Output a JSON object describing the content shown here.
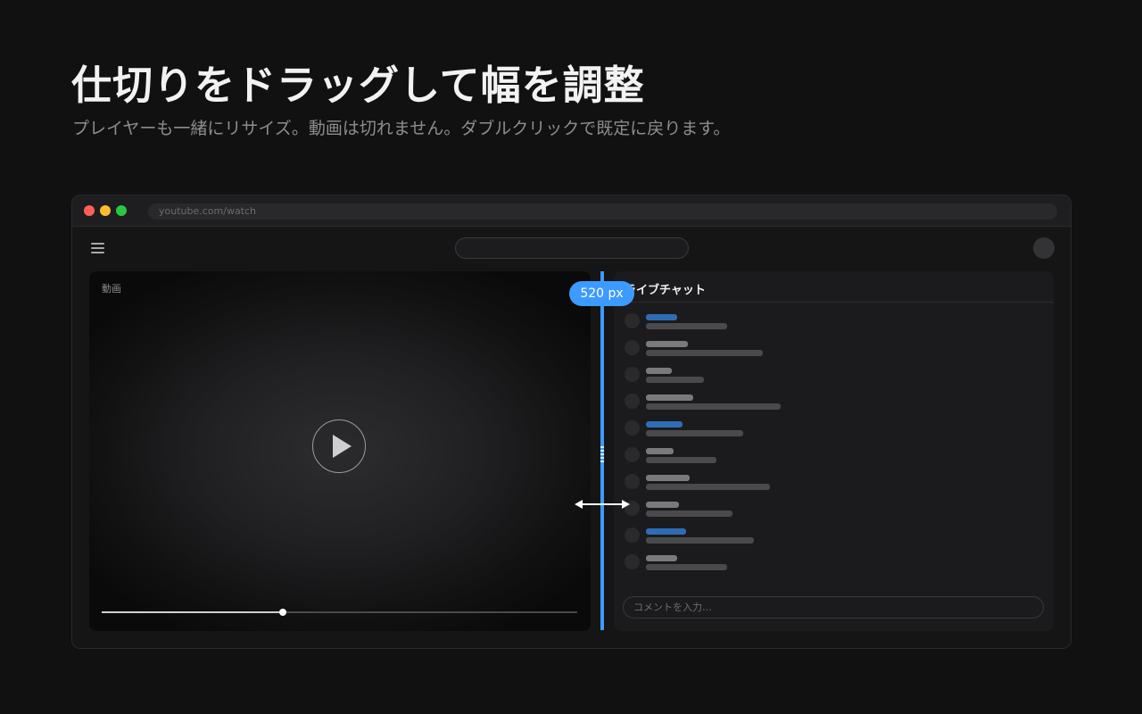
{
  "heading": {
    "title": "仕切りをドラッグして幅を調整",
    "subtitle": "プレイヤーも一緒にリサイズ。動画は切れません。ダブルクリックで既定に戻ります。"
  },
  "browser": {
    "url": "youtube.com/watch"
  },
  "player": {
    "label": "動画",
    "progress_fraction": 0.38
  },
  "divider": {
    "width_label": "520 px",
    "accent_color": "#3d9bff"
  },
  "chat": {
    "title": "ライブチャット",
    "input_placeholder": "コメントを入力…"
  }
}
